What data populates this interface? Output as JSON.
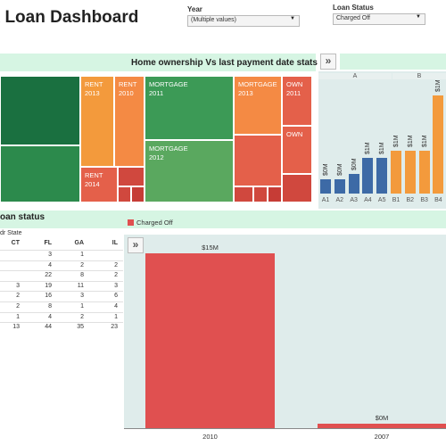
{
  "title": "nk Loan Dashboard",
  "filters": {
    "year": {
      "label": "Year",
      "value": "(Multiple values)"
    },
    "loan_status": {
      "label": "Loan Status",
      "value": "Charged Off"
    }
  },
  "treemap": {
    "title": "Home ownership Vs last payment date stats",
    "tiles": [
      {
        "label": "RENT\n2013",
        "color": "#f39a3c"
      },
      {
        "label": "RENT\n2010",
        "color": "#f48a44"
      },
      {
        "label": "RENT\n2014",
        "color": "#e4604a"
      },
      {
        "label": "MORTGAGE\n2011",
        "color": "#3c9a56"
      },
      {
        "label": "MORTGAGE\n2012",
        "color": "#5aa85f"
      },
      {
        "label": "MORTGAGE\n2013",
        "color": "#f48a44"
      },
      {
        "label": "OWN\n2011",
        "color": "#e4604a"
      },
      {
        "label": "OWN",
        "color": "#e4604a"
      }
    ]
  },
  "grade_chart": {
    "groups": [
      "A",
      "B"
    ],
    "bars": [
      {
        "cat": "A1",
        "label": "$0M",
        "color": "#3d6aa6"
      },
      {
        "cat": "A2",
        "label": "$0M",
        "color": "#3d6aa6"
      },
      {
        "cat": "A3",
        "label": "$0M",
        "color": "#3d6aa6"
      },
      {
        "cat": "A4",
        "label": "$1M",
        "color": "#3d6aa6"
      },
      {
        "cat": "A5",
        "label": "$1M",
        "color": "#3d6aa6"
      },
      {
        "cat": "B1",
        "label": "$1M",
        "color": "#f39a3c"
      },
      {
        "cat": "B2",
        "label": "$1M",
        "color": "#f39a3c"
      },
      {
        "cat": "B3",
        "label": "$1M",
        "color": "#f39a3c"
      },
      {
        "cat": "B4",
        "label": "$1M",
        "color": "#f39a3c"
      }
    ]
  },
  "state_table": {
    "title": "oan status",
    "sub_header": "dr State",
    "columns": [
      "CT",
      "FL",
      "GA",
      "IL"
    ],
    "rows": [
      [
        "",
        "3",
        "1",
        ""
      ],
      [
        "",
        "4",
        "2",
        "2"
      ],
      [
        "",
        "22",
        "8",
        "2"
      ],
      [
        "3",
        "19",
        "11",
        "3"
      ],
      [
        "2",
        "16",
        "3",
        "6"
      ],
      [
        "2",
        "8",
        "1",
        "4"
      ],
      [
        "1",
        "4",
        "2",
        "1"
      ],
      [
        "13",
        "44",
        "35",
        "23"
      ]
    ]
  },
  "year_chart": {
    "legend": "Charged Off",
    "legend_color": "#e05050",
    "bars": [
      {
        "year": "2010",
        "label": "$15M",
        "color": "#e05050"
      },
      {
        "year": "2007",
        "label": "$0M",
        "color": "#e05050"
      }
    ]
  }
}
